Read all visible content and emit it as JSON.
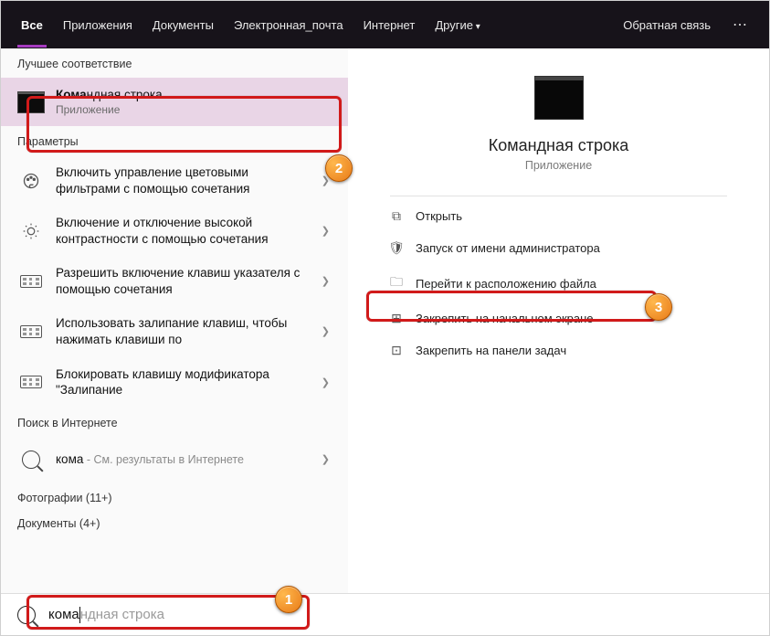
{
  "nav": {
    "tabs": [
      "Все",
      "Приложения",
      "Документы",
      "Электронная_почта",
      "Интернет",
      "Другие"
    ],
    "feedback": "Обратная связь"
  },
  "sections": {
    "bestMatch": "Лучшее соответствие",
    "settings": "Параметры",
    "webSearch": "Поиск в Интернете",
    "photos": "Фотографии (11+)",
    "documents": "Документы (4+)"
  },
  "bestMatch": {
    "title_pre": "Кома",
    "title_post": "ндная строка",
    "sub": "Приложение"
  },
  "settingsItems": [
    "Включить управление цветовыми фильтрами с помощью сочетания",
    "Включение и отключение высокой контрастности с помощью сочетания",
    "Разрешить включение клавиш указателя с помощью сочетания",
    "Использовать залипание клавиш, чтобы нажимать клавиши по",
    "Блокировать клавишу модификатора \"Залипание"
  ],
  "web": {
    "query": "кома",
    "hint": " - См. результаты в Интернете"
  },
  "preview": {
    "title": "Командная строка",
    "sub": "Приложение",
    "actions": [
      "Открыть",
      "Запуск от имени администратора",
      "Перейти к расположению файла",
      "Закрепить на начальном экране",
      "Закрепить на панели задач"
    ]
  },
  "search": {
    "typed": "кома",
    "ghost": "ндная строка"
  },
  "annotations": {
    "b1": "1",
    "b2": "2",
    "b3": "3"
  }
}
